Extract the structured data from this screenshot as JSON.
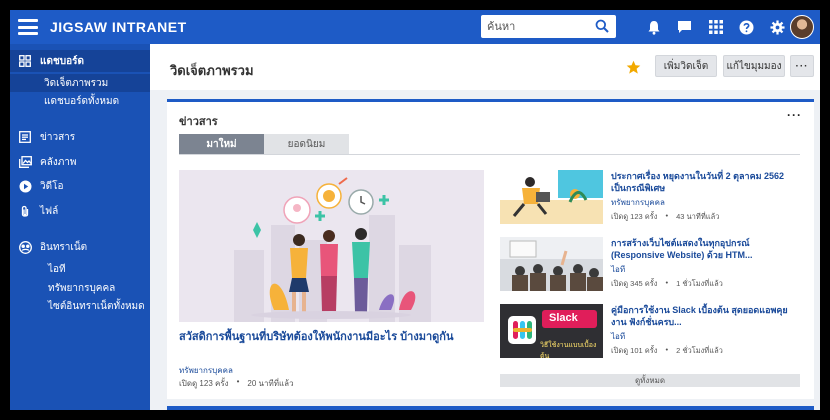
{
  "header": {
    "brand": "JIGSAW INTRANET",
    "search_placeholder": "ค้นหา"
  },
  "sidebar": {
    "dashboard": "แดชบอร์ด",
    "dashboard_sub": [
      "วิดเจ็ตภาพรวม",
      "แดชบอร์ดทั้งหมด"
    ],
    "items": [
      "ข่าวสาร",
      "คลังภาพ",
      "วิดีโอ",
      "ไฟล์"
    ],
    "intranet": "อินทราเน็ต",
    "intranet_sub": [
      "ไอที",
      "ทรัพยากรบุคคล",
      "ไซต์อินทราเน็ตทั้งหมด"
    ]
  },
  "page": {
    "title": "วิดเจ็ตภาพรวม",
    "add_widget": "เพิ่มวิดเจ็ต",
    "edit_view": "แก้ไขมุมมอง",
    "more": "···"
  },
  "news": {
    "title": "ข่าวสาร",
    "more": "···",
    "tabs": [
      "มาใหม่",
      "ยอดนิยม"
    ],
    "featured": {
      "headline": "สวัสดิการพื้นฐานที่บริษัทต้องให้พนักงานมีอะไร บ้างมาดูกัน",
      "category": "ทรัพยากรบุคคล",
      "views": "เปิดดู 123 ครั้ง",
      "time": "20 นาทีที่แล้ว"
    },
    "items": [
      {
        "headline": "ประกาศเรื่อง หยุดงานในวันที่ 2 ตุลาคม 2562 เป็นกรณีพิเศษ",
        "category": "ทรัพยากรบุคคล",
        "views": "เปิดดู 123 ครั้ง",
        "time": "43 นาทีที่แล้ว"
      },
      {
        "headline": "การสร้างเว็บไซต์แสดงในทุกอุปกรณ์ (Responsive Website) ด้วย HTM...",
        "category": "ไอที",
        "views": "เปิดดู 345 ครั้ง",
        "time": "1 ชั่วโมงที่แล้ว"
      },
      {
        "headline": "คู่มือการใช้งาน Slack เบื้องต้น สุดยอดแอพคุยงาน ฟังก์ชั่นครบ...",
        "category": "ไอที",
        "views": "เปิดดู 101 ครั้ง",
        "time": "2 ชั่วโมงที่แล้ว"
      }
    ],
    "dot": "•",
    "thumb3_brand": "Slack",
    "thumb3_caption": "วิธีใช้งานแบบเบื้องต้น",
    "all_news": "ดูทั้งหมด"
  },
  "colors": {
    "topbar": "#1e5bc6",
    "sidebar": "#1a52b5",
    "link": "#1a4a9a"
  }
}
